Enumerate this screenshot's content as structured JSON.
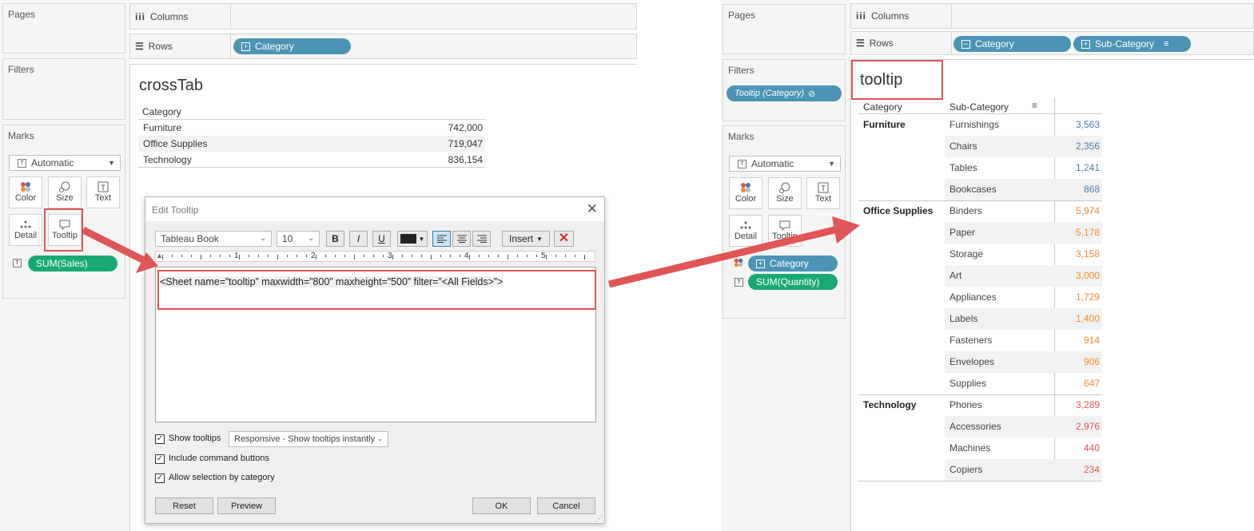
{
  "left": {
    "pages_title": "Pages",
    "filters_title": "Filters",
    "marks_title": "Marks",
    "mark_type": "Automatic",
    "mark_buttons": [
      "Color",
      "Size",
      "Text",
      "Detail",
      "Tooltip"
    ],
    "marks_pill": "SUM(Sales)",
    "columns_label": "Columns",
    "rows_label": "Rows",
    "rows_pill": "Category",
    "sheet_title": "crossTab",
    "table_header": "Category",
    "table_rows": [
      {
        "category": "Furniture",
        "value": "742,000"
      },
      {
        "category": "Office Supplies",
        "value": "719,047"
      },
      {
        "category": "Technology",
        "value": "836,154"
      }
    ]
  },
  "dialog": {
    "title": "Edit Tooltip",
    "font": "Tableau Book",
    "size": "10",
    "bold": "B",
    "italic": "I",
    "underline": "U",
    "insert": "Insert",
    "ruler_numbers": [
      "1",
      "2",
      "3",
      "4",
      "5"
    ],
    "content": "<Sheet name=”tooltip” maxwidth=”800” maxheight=”500” filter=”<All Fields>”>",
    "show_tooltips": "Show tooltips",
    "tooltip_mode": "Responsive - Show tooltips instantly",
    "include_buttons": "Include command buttons",
    "allow_selection": "Allow selection by category",
    "reset": "Reset",
    "preview": "Preview",
    "ok": "OK",
    "cancel": "Cancel"
  },
  "right": {
    "pages_title": "Pages",
    "filters_title": "Filters",
    "filter_pill": "Tooltip (Category)",
    "marks_title": "Marks",
    "mark_type": "Automatic",
    "mark_buttons": [
      "Color",
      "Size",
      "Text",
      "Detail",
      "Tooltip"
    ],
    "color_pill": "Category",
    "text_pill": "SUM(Quantity)",
    "columns_label": "Columns",
    "rows_label": "Rows",
    "rows_pills": [
      "Category",
      "Sub-Category"
    ],
    "sheet_title": "tooltip",
    "header_category": "Category",
    "header_subcategory": "Sub-Category",
    "groups": [
      {
        "category": "Furniture",
        "color": "#4e79a7",
        "rows": [
          {
            "sub": "Furnishings",
            "value": "3,563"
          },
          {
            "sub": "Chairs",
            "value": "2,356"
          },
          {
            "sub": "Tables",
            "value": "1,241"
          },
          {
            "sub": "Bookcases",
            "value": "868"
          }
        ]
      },
      {
        "category": "Office Supplies",
        "color": "#f28e2b",
        "rows": [
          {
            "sub": "Binders",
            "value": "5,974"
          },
          {
            "sub": "Paper",
            "value": "5,178"
          },
          {
            "sub": "Storage",
            "value": "3,158"
          },
          {
            "sub": "Art",
            "value": "3,000"
          },
          {
            "sub": "Appliances",
            "value": "1,729"
          },
          {
            "sub": "Labels",
            "value": "1,400"
          },
          {
            "sub": "Fasteners",
            "value": "914"
          },
          {
            "sub": "Envelopes",
            "value": "906"
          },
          {
            "sub": "Supplies",
            "value": "647"
          }
        ]
      },
      {
        "category": "Technology",
        "color": "#e15759",
        "rows": [
          {
            "sub": "Phones",
            "value": "3,289"
          },
          {
            "sub": "Accessories",
            "value": "2,976"
          },
          {
            "sub": "Machines",
            "value": "440"
          },
          {
            "sub": "Copiers",
            "value": "234"
          }
        ]
      }
    ]
  },
  "colors": {
    "pill_blue": "#4b94b5",
    "pill_green": "#19a974",
    "annotation_red": "#e05555"
  }
}
